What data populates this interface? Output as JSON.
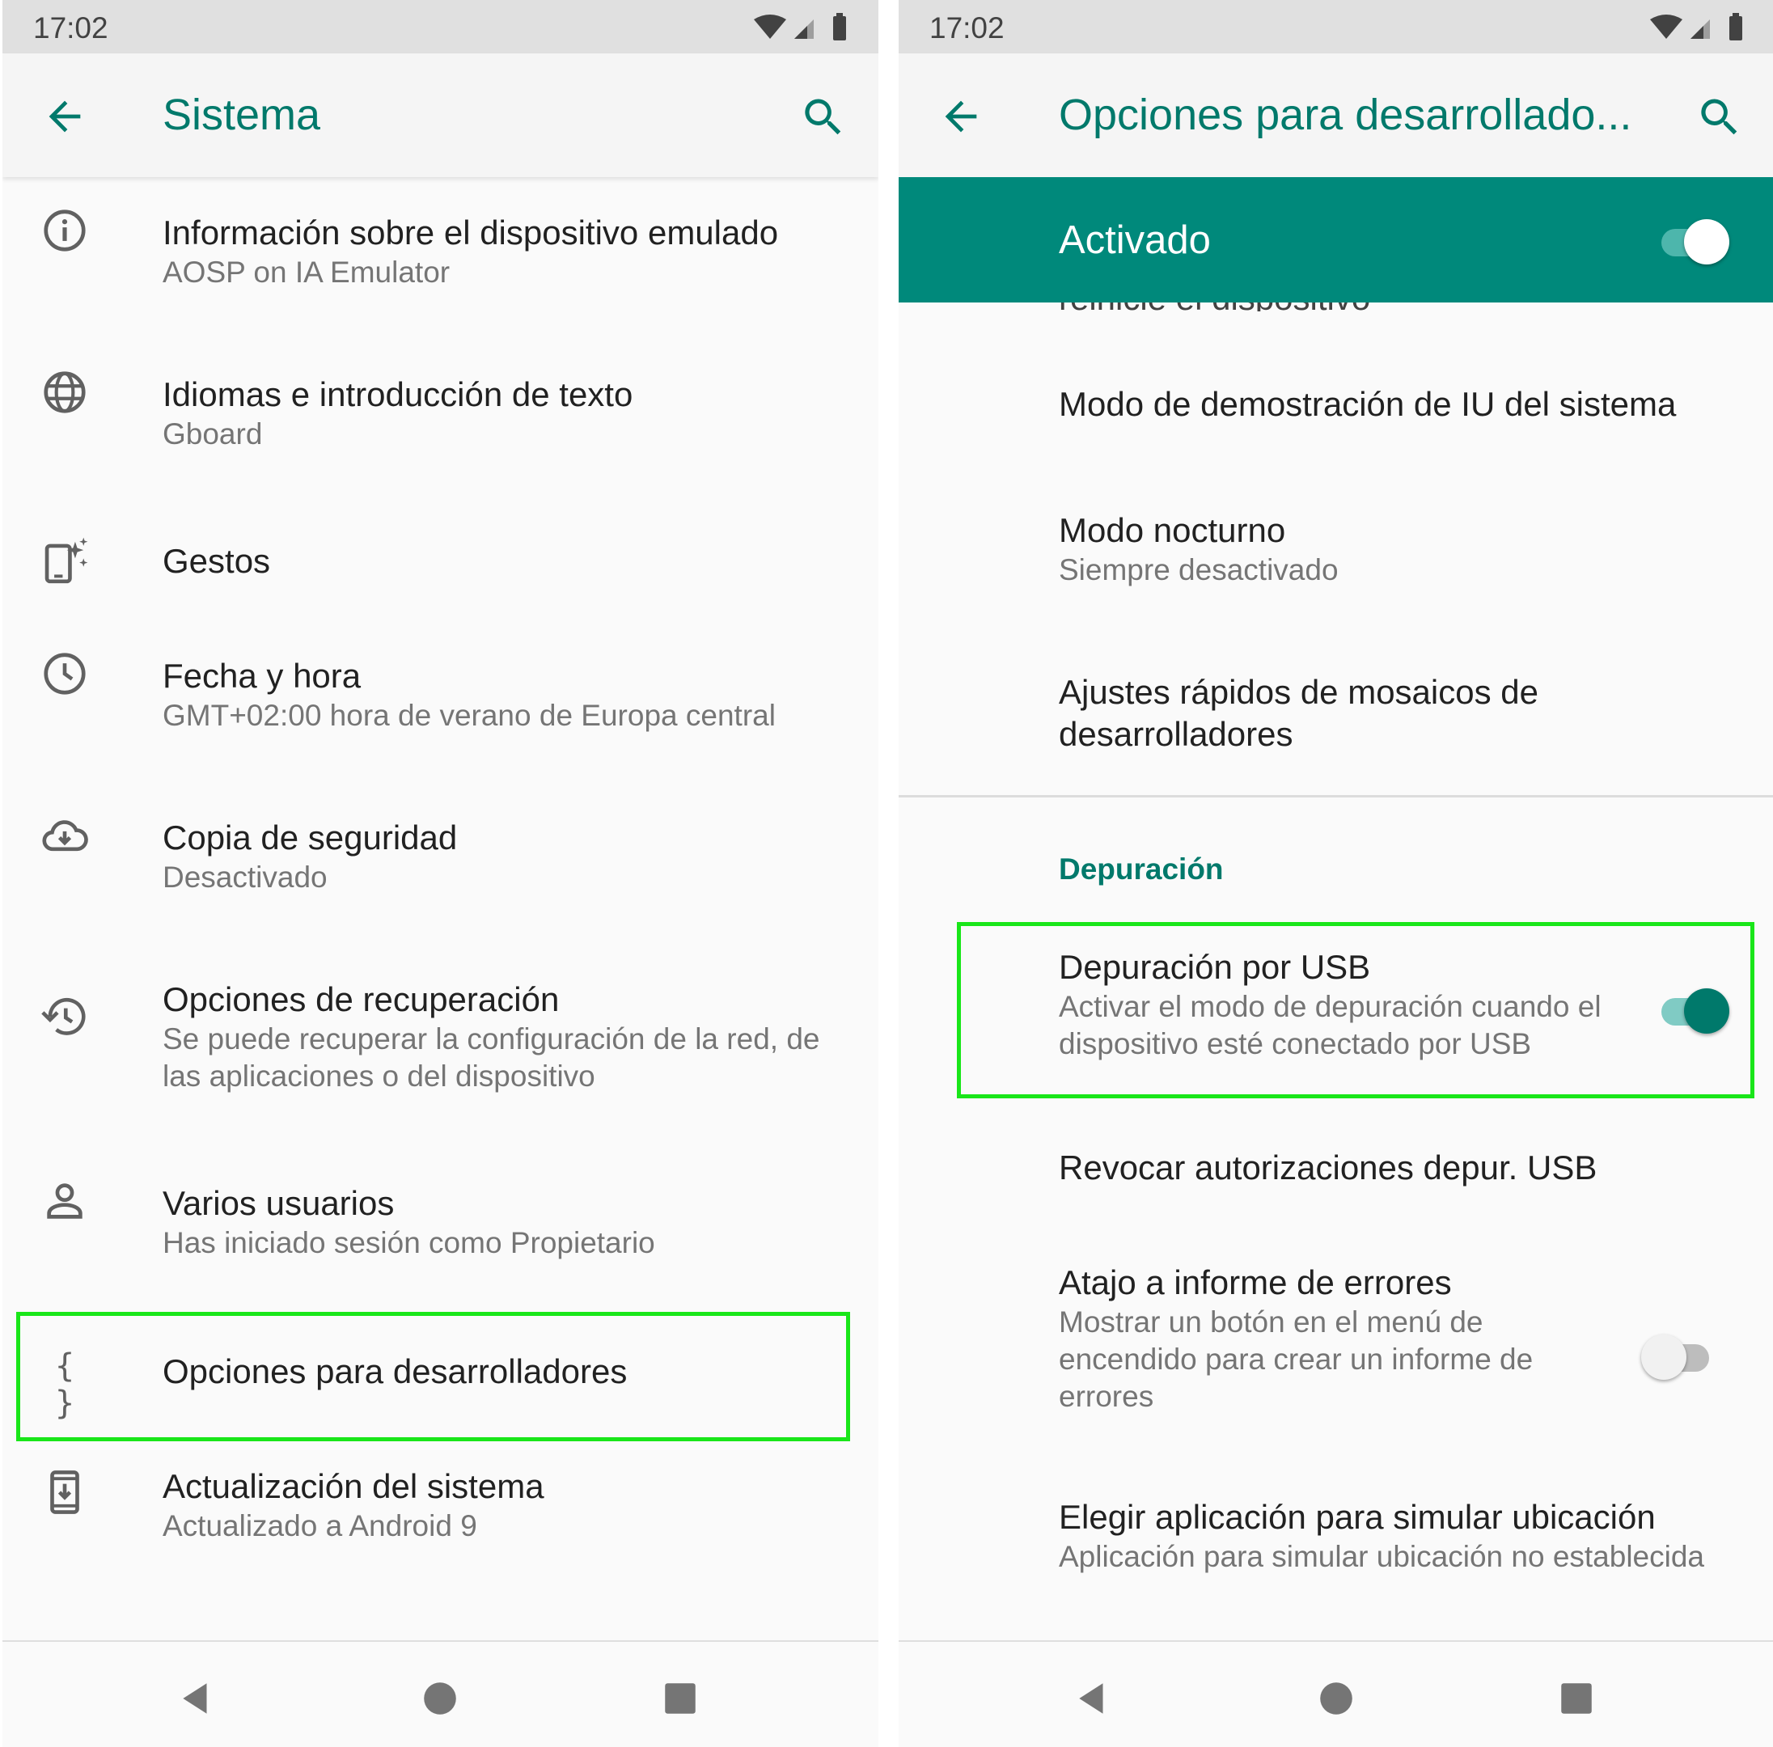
{
  "left": {
    "status_time": "17:02",
    "title": "Sistema",
    "items": [
      {
        "title": "Información sobre el dispositivo emulado",
        "subtitle": "AOSP on IA Emulator",
        "icon": "info-icon"
      },
      {
        "title": "Idiomas e introducción de texto",
        "subtitle": "Gboard",
        "icon": "globe-icon"
      },
      {
        "title": "Gestos",
        "subtitle": "",
        "icon": "gesture-phone-icon"
      },
      {
        "title": "Fecha y hora",
        "subtitle": "GMT+02:00 hora de verano de Europa central",
        "icon": "clock-icon"
      },
      {
        "title": "Copia de seguridad",
        "subtitle": "Desactivado",
        "icon": "cloud-backup-icon"
      },
      {
        "title": "Opciones de recuperación",
        "subtitle": "Se puede recuperar la configuración de la red, de las aplicaciones o del dispositivo",
        "icon": "history-icon"
      },
      {
        "title": "Varios usuarios",
        "subtitle": "Has iniciado sesión como Propietario",
        "icon": "person-icon"
      },
      {
        "title": "Opciones para desarrolladores",
        "subtitle": "",
        "icon": "braces-icon",
        "icon_text": "{ }"
      },
      {
        "title": "Actualización del sistema",
        "subtitle": "Actualizado a Android 9",
        "icon": "system-update-icon"
      }
    ]
  },
  "right": {
    "status_time": "17:02",
    "title": "Opciones para desarrollado...",
    "master_label": "Activado",
    "master_on": true,
    "partial_text": "reinicie el dispositivo",
    "items_top": [
      {
        "title": "Modo de demostración de IU del sistema",
        "subtitle": ""
      },
      {
        "title": "Modo nocturno",
        "subtitle": "Siempre desactivado"
      },
      {
        "title": "Ajustes rápidos de mosaicos de desarrolladores",
        "subtitle": ""
      }
    ],
    "section_header": "Depuración",
    "usb_debugging": {
      "title": "Depuración por USB",
      "subtitle": "Activar el modo de depuración cuando el dispositivo esté conectado por USB",
      "on": true
    },
    "revoke": {
      "title": "Revocar autorizaciones depur. USB"
    },
    "bug_report": {
      "title": "Atajo a informe de errores",
      "subtitle": "Mostrar un botón en el menú de encendido para crear un informe de errores",
      "on": false
    },
    "mock_location": {
      "title": "Elegir aplicación para simular ubicación",
      "subtitle": "Aplicación para simular ubicación no establecida"
    }
  },
  "colors": {
    "accent": "#00796b",
    "master_bar": "#00897b",
    "highlight": "#19e619",
    "switch_on_thumb": "#00796b",
    "switch_on_track": "#80cbc4"
  }
}
